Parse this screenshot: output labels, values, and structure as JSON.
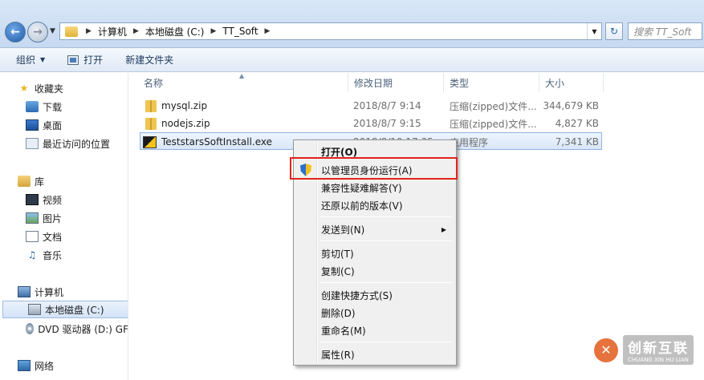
{
  "address": {
    "crumbs": [
      "计算机",
      "本地磁盘 (C:)",
      "TT_Soft"
    ],
    "search_placeholder": "搜索 TT_Soft"
  },
  "toolbar": {
    "organize": "组织",
    "open": "打开",
    "new_folder": "新建文件夹"
  },
  "sidebar": {
    "favorites": "收藏夹",
    "downloads": "下载",
    "desktop": "桌面",
    "recent": "最近访问的位置",
    "libraries": "库",
    "videos": "视频",
    "pictures": "图片",
    "documents": "文档",
    "music": "音乐",
    "computer": "计算机",
    "local_disk": "本地磁盘 (C:)",
    "dvd": "DVD 驱动器 (D:) GF",
    "network": "网络"
  },
  "columns": {
    "name": "名称",
    "date": "修改日期",
    "type": "类型",
    "size": "大小"
  },
  "files": [
    {
      "name": "mysql.zip",
      "date": "2018/8/7 9:14",
      "type": "压缩(zipped)文件...",
      "size": "344,679 KB"
    },
    {
      "name": "nodejs.zip",
      "date": "2018/8/7 9:15",
      "type": "压缩(zipped)文件...",
      "size": "4,827 KB"
    },
    {
      "name": "TeststarsSoftInstall.exe",
      "date": "2018/8/10 17:35",
      "type": "应用程序",
      "size": "7,341 KB"
    }
  ],
  "context_menu": {
    "open": "打开(O)",
    "run_as_admin": "以管理员身份运行(A)",
    "compat": "兼容性疑难解答(Y)",
    "restore": "还原以前的版本(V)",
    "send_to": "发送到(N)",
    "cut": "剪切(T)",
    "copy": "复制(C)",
    "shortcut": "创建快捷方式(S)",
    "delete": "删除(D)",
    "rename": "重命名(M)",
    "properties": "属性(R)"
  },
  "watermark": {
    "text": "创新互联",
    "sub": "CHUANG XIN HU LIAN"
  },
  "colors": {
    "highlight": "#e2231a",
    "selection": "#d7e6f8"
  }
}
